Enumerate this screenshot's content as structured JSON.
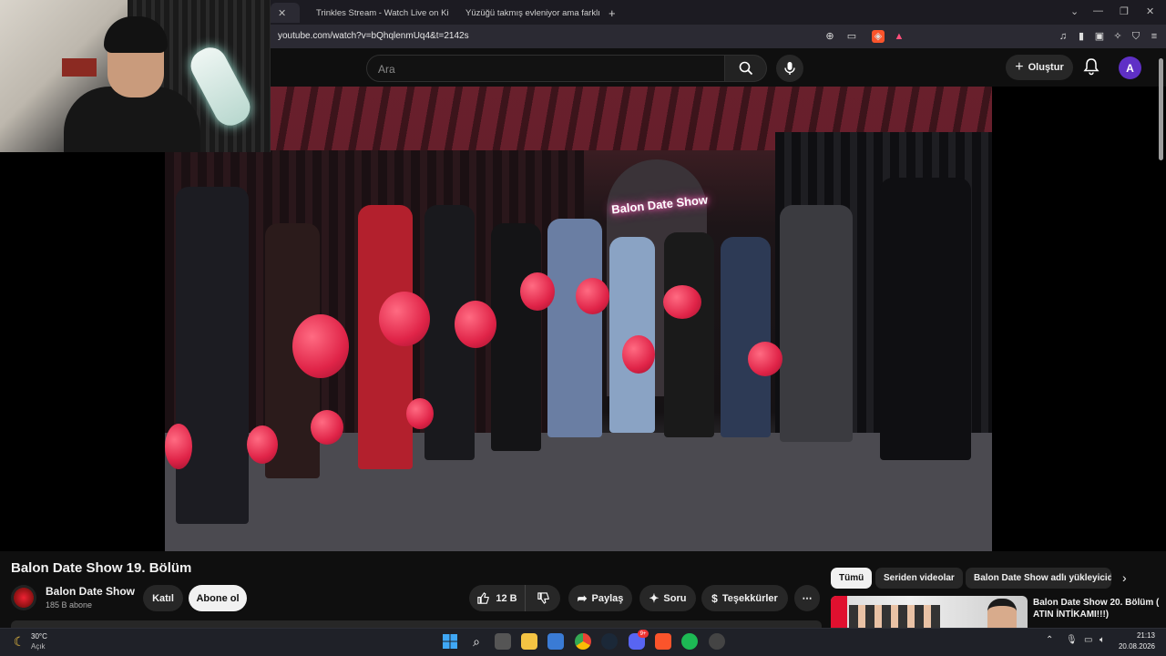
{
  "browser": {
    "tabs": [
      {
        "label": ""
      },
      {
        "label": "Trinkles Stream - Watch Live on Kick"
      },
      {
        "label": "Yüzüğü takmış evleniyor ama farklı v"
      }
    ],
    "new_tab": "+",
    "url": "youtube.com/watch?v=bQhqlenmUq4&t=2142s"
  },
  "youtube": {
    "search_placeholder": "Ara",
    "create_label": "Oluştur",
    "avatar_letter": "A"
  },
  "video": {
    "neon_sign": "Balon Date Show",
    "title": "Balon Date Show 19. Bölüm",
    "channel": "Balon Date Show",
    "subscribers": "185 B abone",
    "join_label": "Katıl",
    "subscribe_label": "Abone ol",
    "likes": "12 B",
    "share_label": "Paylaş",
    "ask_label": "Soru",
    "thanks_label": "Teşekkürler",
    "more_label": "⋯"
  },
  "sidebar": {
    "chips": [
      "Tümü",
      "Seriden videolar",
      "Balon Date Show adlı yükleyiciden"
    ],
    "recommended": [
      {
        "title": "Balon Date Show 20. Bölüm ( ATIN İNTİKAMI!!!)"
      }
    ]
  },
  "taskbar": {
    "weather_temp": "30°C",
    "weather_desc": "Açık",
    "time": "21:13",
    "date": "20.08.2026",
    "badge": "9+"
  },
  "colors": {
    "accent_red": "#ff0033",
    "youtube_bg": "#0f0f0f",
    "avatar": "#5f30c6"
  }
}
